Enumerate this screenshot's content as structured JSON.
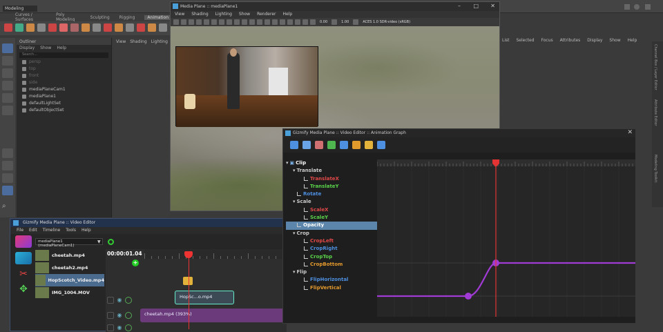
{
  "maya": {
    "workspace_select": "Modeling",
    "shelf_tabs": [
      "Curves / Surfaces",
      "Poly Modeling",
      "Sculpting",
      "Rigging",
      "Animation"
    ],
    "active_shelf_tab": "Animation",
    "outliner": {
      "title": "Outliner",
      "menu": [
        "Display",
        "Show",
        "Help"
      ],
      "search_placeholder": "Search...",
      "items": [
        {
          "label": "persp",
          "dim": true
        },
        {
          "label": "top",
          "dim": true
        },
        {
          "label": "front",
          "dim": true
        },
        {
          "label": "side",
          "dim": true
        },
        {
          "label": "mediaPlaneCam1",
          "dim": false
        },
        {
          "label": "mediaPlane1",
          "dim": false
        },
        {
          "label": "defaultLightSet",
          "dim": false
        },
        {
          "label": "defaultObjectSet",
          "dim": false
        }
      ]
    },
    "viewport_menu": [
      "View",
      "Shading",
      "Lighting"
    ],
    "right_menu": [
      "List",
      "Selected",
      "Focus",
      "Attributes",
      "Display",
      "Show",
      "Help"
    ],
    "right_edge_tabs": [
      "Channel Box / Layer Editor",
      "Attribute Editor",
      "Modeling Toolkit"
    ]
  },
  "media_plane": {
    "title": "Media Plane :: mediaPlane1",
    "menu": [
      "View",
      "Shading",
      "Lighting",
      "Show",
      "Renderer",
      "Help"
    ],
    "exposure": "0.00",
    "gamma": "1.00",
    "color_space": "ACES 1.0 SDR-video (sRGB)"
  },
  "video_editor": {
    "title": "Gizmify Media Plane :: Video Editor",
    "menu": [
      "File",
      "Edit",
      "Timeline",
      "Tools",
      "Help"
    ],
    "camera_select": "mediaPlane1 (mediaPlaneCam1)",
    "clips": [
      {
        "label": "cheetah.mp4",
        "selected": false
      },
      {
        "label": "cheetah2.mp4",
        "selected": false
      },
      {
        "label": "HopScotch_Video.mp4",
        "selected": true
      },
      {
        "label": "IMG_1004.MOV",
        "selected": false
      }
    ],
    "timecode": "00:00:01.04",
    "track_clip_1": "HopSc...o.mp4",
    "track_clip_2": "cheetah.mp4 (393%)"
  },
  "animation_graph": {
    "title": "Gizmify Media Plane :: Video Editor :: Animation Graph",
    "tree": [
      {
        "label": "Clip",
        "level": 0,
        "color": "#ffffff",
        "arrow": true,
        "selected": false
      },
      {
        "label": "Translate",
        "level": 1,
        "color": "#cccccc",
        "arrow": true,
        "selected": false
      },
      {
        "label": "TranslateX",
        "level": 2,
        "color": "#e04848",
        "arrow": false,
        "selected": false
      },
      {
        "label": "TranslateY",
        "level": 2,
        "color": "#5ad24a",
        "arrow": false,
        "selected": false
      },
      {
        "label": "Rotate",
        "level": 1,
        "color": "#4d8fe0",
        "arrow": false,
        "selected": false
      },
      {
        "label": "Scale",
        "level": 1,
        "color": "#cccccc",
        "arrow": true,
        "selected": false
      },
      {
        "label": "ScaleX",
        "level": 2,
        "color": "#e04848",
        "arrow": false,
        "selected": false
      },
      {
        "label": "ScaleY",
        "level": 2,
        "color": "#5ad24a",
        "arrow": false,
        "selected": false
      },
      {
        "label": "Opacity",
        "level": 1,
        "color": "#ffffff",
        "arrow": false,
        "selected": true
      },
      {
        "label": "Crop",
        "level": 1,
        "color": "#cccccc",
        "arrow": true,
        "selected": false
      },
      {
        "label": "CropLeft",
        "level": 2,
        "color": "#e04848",
        "arrow": false,
        "selected": false
      },
      {
        "label": "CropRight",
        "level": 2,
        "color": "#4d8fe0",
        "arrow": false,
        "selected": false
      },
      {
        "label": "CropTop",
        "level": 2,
        "color": "#5ad24a",
        "arrow": false,
        "selected": false
      },
      {
        "label": "CropBottom",
        "level": 2,
        "color": "#e39a2d",
        "arrow": false,
        "selected": false
      },
      {
        "label": "Flip",
        "level": 1,
        "color": "#cccccc",
        "arrow": true,
        "selected": false
      },
      {
        "label": "FlipHorizontal",
        "level": 2,
        "color": "#4d8fe0",
        "arrow": false,
        "selected": false
      },
      {
        "label": "FlipVertical",
        "level": 2,
        "color": "#e39a2d",
        "arrow": false,
        "selected": false
      }
    ],
    "curve_color": "#a23ad6",
    "playhead_color": "#e33333"
  }
}
